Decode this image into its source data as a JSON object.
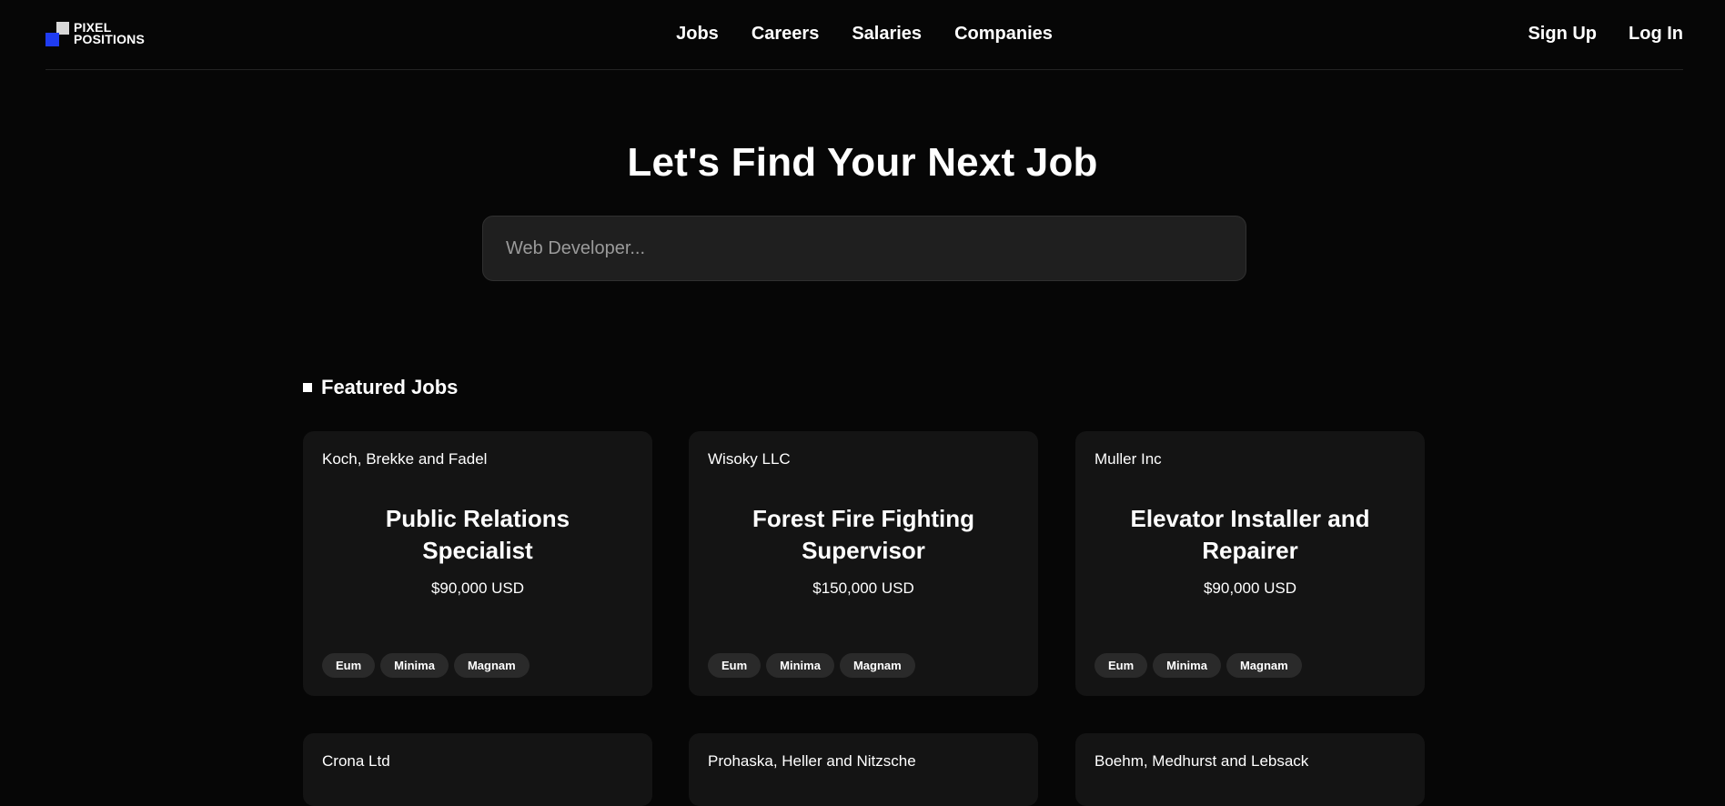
{
  "brand": {
    "line1": "PIXEL",
    "line2": "POSITIONS",
    "colors": {
      "front_square": "#1f3cf2",
      "back_square": "#d8d8d8"
    }
  },
  "nav": {
    "links": [
      "Jobs",
      "Careers",
      "Salaries",
      "Companies"
    ],
    "auth": [
      "Sign Up",
      "Log In"
    ]
  },
  "hero": {
    "title": "Let's Find Your Next Job",
    "search_placeholder": "Web Developer..."
  },
  "featured": {
    "heading": "Featured Jobs",
    "jobs": [
      {
        "company": "Koch, Brekke and Fadel",
        "title": "Public Relations Specialist",
        "salary": "$90,000 USD",
        "tags": [
          "Eum",
          "Minima",
          "Magnam"
        ]
      },
      {
        "company": "Wisoky LLC",
        "title": "Forest Fire Fighting Supervisor",
        "salary": "$150,000 USD",
        "tags": [
          "Eum",
          "Minima",
          "Magnam"
        ]
      },
      {
        "company": "Muller Inc",
        "title": "Elevator Installer and Repairer",
        "salary": "$90,000 USD",
        "tags": [
          "Eum",
          "Minima",
          "Magnam"
        ]
      },
      {
        "company": "Crona Ltd"
      },
      {
        "company": "Prohaska, Heller and Nitzsche"
      },
      {
        "company": "Boehm, Medhurst and Lebsack"
      }
    ]
  },
  "colors": {
    "background": "#060606",
    "card": "#141414",
    "tag": "#2a2a2a",
    "search": "#1f1f1f"
  }
}
